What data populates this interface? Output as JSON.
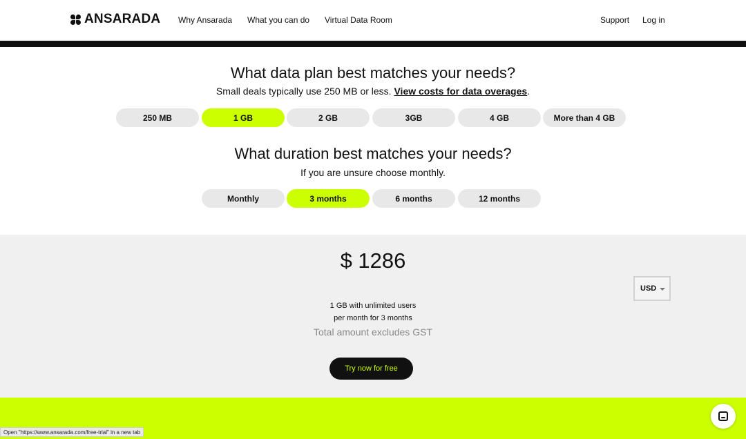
{
  "nav": {
    "brand": "ANSARADA",
    "links": [
      "Why Ansarada",
      "What you can do",
      "Virtual Data Room"
    ],
    "support": "Support",
    "login": "Log in"
  },
  "data_plan": {
    "title": "What data plan best matches your needs?",
    "subtitle": "Small deals typically use 250 MB or less.",
    "link": "View costs for data overages",
    "link_suffix": ".",
    "options": [
      "250 MB",
      "1 GB",
      "2 GB",
      "3GB",
      "4 GB",
      "More than 4 GB"
    ],
    "selected": "1 GB"
  },
  "duration": {
    "title": "What duration best matches your needs?",
    "subtitle": "If you are unsure choose monthly.",
    "options": [
      "Monthly",
      "3 months",
      "6 months",
      "12 months"
    ],
    "selected": "3 months"
  },
  "pricing": {
    "price": "$ 1286",
    "currency": "USD",
    "line1": "1 GB with unlimited users",
    "line2": "per month for 3 months",
    "gst_note": "Total amount excludes GST",
    "cta": "Try now for free"
  },
  "status_bar": "Open \"https://www.ansarada.com/free-trial\" in a new tab",
  "colors": {
    "accent": "#ccff00",
    "dark": "#111111",
    "panel": "#f0f0f0",
    "pill": "#e8e8e8"
  },
  "icons": {
    "chat": "chat-icon",
    "caret": "chevron-down-icon"
  }
}
